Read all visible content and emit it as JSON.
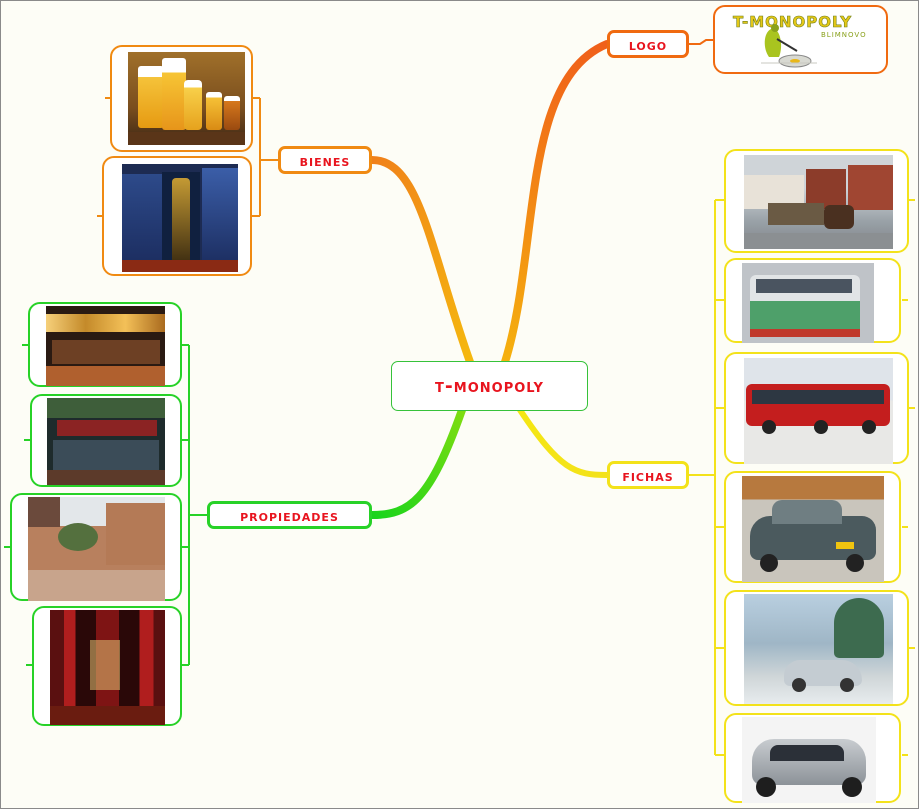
{
  "central": {
    "label": "T-MONOPOLY"
  },
  "branches": {
    "bienes": "Bienes",
    "logo": "LOGO",
    "fichas": "Fichas",
    "propiedades": "Propiedades"
  },
  "logo_image": {
    "title": "T-MONOPOLY",
    "subtitle": "BLIMNOVO"
  },
  "colors": {
    "bienes": "#f08a12",
    "logo": "#f06a10",
    "fichas": "#f3e21a",
    "propiedades": "#27d227",
    "label_text": "#e8141e"
  }
}
